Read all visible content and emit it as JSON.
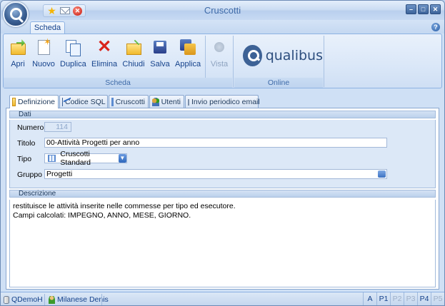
{
  "window": {
    "title": "Cruscotti",
    "controls": [
      "minimize-icon",
      "maximize-icon",
      "close-icon"
    ]
  },
  "quick_access": [
    "star-icon",
    "mail-icon",
    "close-circle-icon"
  ],
  "ribbon": {
    "tab": "Scheda",
    "groups": {
      "scheda": {
        "label": "Scheda",
        "buttons": [
          {
            "label": "Apri",
            "icon": "folder-open-icon"
          },
          {
            "label": "Nuovo",
            "icon": "new-document-icon"
          },
          {
            "label": "Duplica",
            "icon": "duplicate-icon"
          },
          {
            "label": "Elimina",
            "icon": "delete-icon"
          },
          {
            "label": "Chiudi",
            "icon": "close-folder-icon"
          },
          {
            "label": "Salva",
            "icon": "save-icon"
          },
          {
            "label": "Applica",
            "icon": "apply-icon"
          },
          {
            "label": "Vista",
            "icon": "view-icon",
            "disabled": true
          }
        ]
      },
      "online": {
        "label": "Online",
        "logo_text": "qualibus"
      }
    }
  },
  "tabs": [
    {
      "label": "Definizione",
      "icon": "folder-icon",
      "active": true
    },
    {
      "label": "Codice SQL",
      "icon": "chart-icon"
    },
    {
      "label": "Cruscotti",
      "icon": "grid-icon"
    },
    {
      "label": "Utenti",
      "icon": "users-icon"
    },
    {
      "label": "Invio periodico email",
      "icon": "mail-icon"
    }
  ],
  "dati": {
    "header": "Dati",
    "numero_label": "Numero",
    "numero_value": "114",
    "titolo_label": "Titolo",
    "titolo_value": "00-Attività Progetti per anno",
    "tipo_label": "Tipo",
    "tipo_value": "Cruscotti Standard",
    "gruppo_label": "Gruppo",
    "gruppo_value": "Progetti"
  },
  "descrizione": {
    "header": "Descrizione",
    "text": "restituisce le attività inserite nelle commesse per tipo ed esecutore.\nCampi calcolati: IMPEGNO, ANNO, MESE, GIORNO."
  },
  "statusbar": {
    "database": "QDemoH",
    "user": "Milanese Denis",
    "cells": [
      {
        "label": "A",
        "active": true
      },
      {
        "label": "P1",
        "active": true
      },
      {
        "label": "P2",
        "active": false
      },
      {
        "label": "P3",
        "active": false
      },
      {
        "label": "P4",
        "active": true
      },
      {
        "label": "P5",
        "active": false
      }
    ]
  },
  "colors": {
    "accent": "#15428b",
    "title": "#3e6aa8",
    "background": "#bfd4ee"
  }
}
